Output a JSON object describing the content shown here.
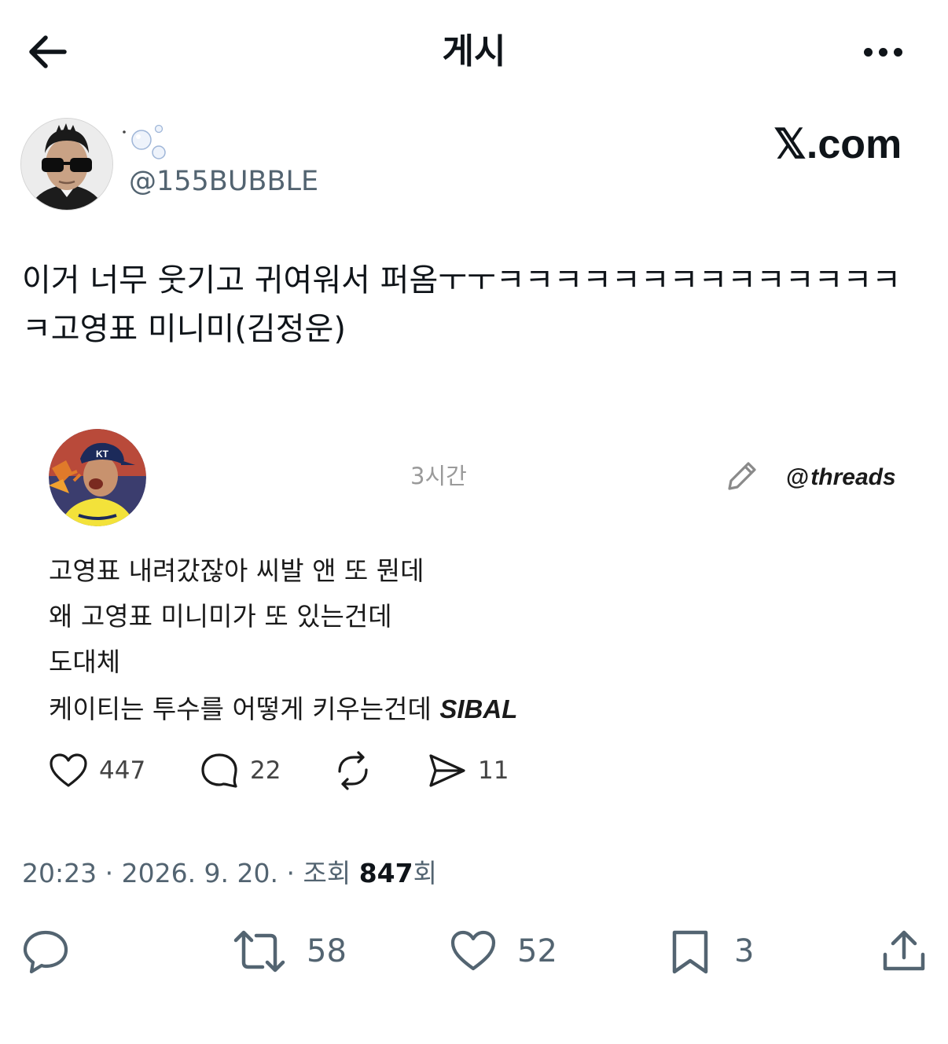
{
  "header": {
    "title": "게시"
  },
  "author": {
    "handle": "@155BUBBLE"
  },
  "brand": {
    "x_glyph": "𝕏",
    "suffix": ".com"
  },
  "post": {
    "text": "이거 너무 웃기고 귀여워서 퍼옴ㅜㅜㅋㅋㅋㅋㅋㅋㅋㅋㅋㅋㅋㅋㅋㅋ\nㅋ고영표 미니미(김정운)"
  },
  "threads_embed": {
    "time": "3시간",
    "logo_glyph": "@",
    "logo_text": "threads",
    "lines": [
      "고영표 내려갔잖아 씨발 앤 또 뭔데",
      "왜 고영표 미니미가 또 있는건데",
      "도대체",
      "케이티는 투수를 어떻게 키우는건데 "
    ],
    "emphasis": "SIBAL",
    "stats": {
      "likes": "447",
      "replies": "22",
      "shares": "11"
    }
  },
  "meta": {
    "time": "20:23",
    "sep": " · ",
    "date": "2026. 9. 20.",
    "views_prefix": "조회 ",
    "views": "847",
    "views_suffix": "회"
  },
  "actions": {
    "reposts": "58",
    "likes": "52",
    "bookmarks": "3"
  }
}
